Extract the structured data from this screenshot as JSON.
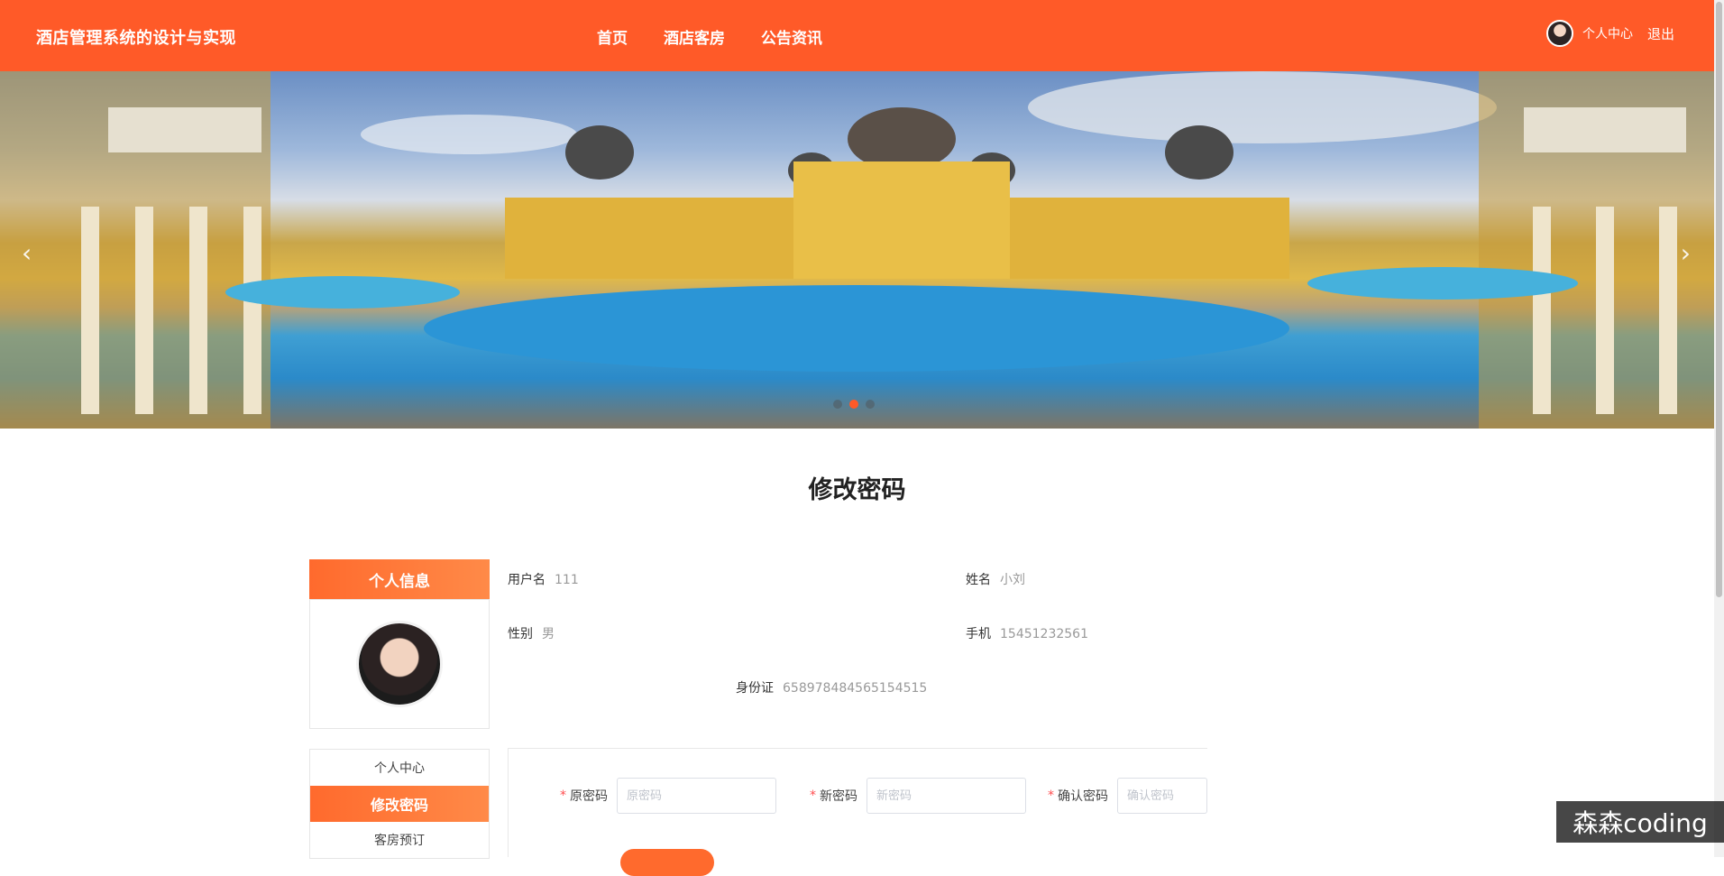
{
  "header": {
    "brand": "酒店管理系统的设计与实现",
    "nav": [
      "首页",
      "酒店客房",
      "公告资讯"
    ],
    "user_center": "个人中心",
    "logout": "退出"
  },
  "banner": {
    "prev_icon": "chevron-left-icon",
    "next_icon": "chevron-right-icon",
    "dots": 3,
    "active_dot": 2
  },
  "page_title": "修改密码",
  "sidebar": {
    "header": "个人信息",
    "menu": [
      "个人中心",
      "修改密码",
      "客房预订"
    ],
    "active": "修改密码"
  },
  "profile": {
    "username_label": "用户名",
    "username": "111",
    "name_label": "姓名",
    "name": "小刘",
    "gender_label": "性别",
    "gender": "男",
    "phone_label": "手机",
    "phone": "15451232561",
    "id_label": "身份证",
    "id_number": "658978484565154515"
  },
  "form": {
    "old_label": "原密码",
    "old_placeholder": "原密码",
    "new_label": "新密码",
    "new_placeholder": "新密码",
    "confirm_label": "确认密码",
    "confirm_placeholder": "确认密码"
  },
  "watermark": "森森coding",
  "colors": {
    "accent": "#ff5a28"
  }
}
